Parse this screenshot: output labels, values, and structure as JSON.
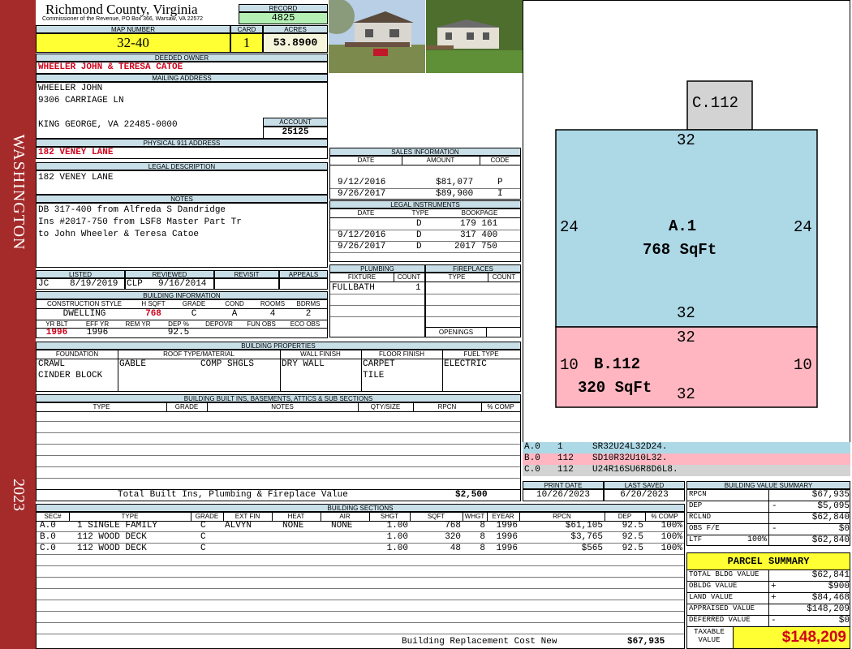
{
  "side": {
    "district": "WASHINGTON",
    "year": "2023"
  },
  "county": {
    "name": "Richmond County, Virginia",
    "office": "Commissioner of the Revenue, PO Box 366, Warsaw, VA 22572"
  },
  "labels": {
    "record": "RECORD",
    "map_number": "MAP NUMBER",
    "card": "CARD",
    "acres": "ACRES",
    "deeded_owner": "DEEDED OWNER",
    "mailing_address": "MAILING ADDRESS",
    "account": "ACCOUNT",
    "physical_address": "PHYSICAL 911 ADDRESS",
    "legal_description": "LEGAL DESCRIPTION",
    "notes": "NOTES",
    "sales_information": "SALES INFORMATION",
    "date": "DATE",
    "amount": "AMOUNT",
    "code": "CODE",
    "legal_instruments": "LEGAL INSTRUMENTS",
    "type": "TYPE",
    "bookpage": "BOOKPAGE",
    "plumbing": "PLUMBING",
    "fireplaces": "FIREPLACES",
    "fixture": "FIXTURE",
    "count": "COUNT",
    "openings": "OPENINGS",
    "listed": "LISTED",
    "reviewed": "REVIEWED",
    "revisit": "REVISIT",
    "appeals": "APPEALS",
    "building_information": "BUILDING INFORMATION",
    "construction_style": "CONSTRUCTION STYLE",
    "h_sqft": "H SQFT",
    "grade": "GRADE",
    "cond": "COND",
    "rooms": "ROOMS",
    "bdrms": "BDRMS",
    "yr_blt": "YR BLT",
    "eff_yr": "EFF YR",
    "rem_yr": "REM YR",
    "dep_pct": "DEP %",
    "depovr": "DEPOVR",
    "fun_obs": "FUN OBS",
    "eco_obs": "ECO OBS",
    "building_properties": "BUILDING PROPERTIES",
    "foundation": "FOUNDATION",
    "roof": "ROOF TYPE/MATERIAL",
    "wall_finish": "WALL FINISH",
    "floor_finish": "FLOOR FINISH",
    "fuel_type": "FUEL TYPE",
    "built_ins": "BUILDING BUILT INS, BASEMENTS, ATTICS & SUB SECTIONS",
    "notes_col": "NOTES",
    "qty_size": "QTY/SIZE",
    "rpcn": "RPCN",
    "pct_comp": "% COMP",
    "print_date": "PRINT DATE",
    "last_saved": "LAST SAVED",
    "building_value_summary": "BUILDING VALUE SUMMARY",
    "building_sections": "BUILDING SECTIONS",
    "sec": "SEC#",
    "ext_fin": "EXT FIN",
    "heat": "HEAT",
    "air": "AIR",
    "shgt": "SHGT",
    "sqft": "SQFT",
    "whgt": "WHGT",
    "eyear": "EYEAR",
    "dep": "DEP"
  },
  "record": "4825",
  "map_number": "32-40",
  "card": "1",
  "acres": "53.8900",
  "owner": "WHEELER JOHN & TERESA CATOE",
  "mailing": [
    "WHEELER JOHN",
    "9306 CARRIAGE LN",
    "",
    "KING GEORGE, VA 22485-0000"
  ],
  "account": "25125",
  "physical_address": "182 VENEY LANE",
  "legal_description": "182 VENEY LANE",
  "notes": [
    "DB 317-400 from Alfreda S Dandridge",
    "Ins #2017-750 from LSF8 Master Part Tr",
    "to John Wheeler & Teresa Catoe"
  ],
  "sales": [
    {
      "date": "9/12/2016",
      "amount": "$81,077",
      "code": "P"
    },
    {
      "date": "9/26/2017",
      "amount": "$89,900",
      "code": "I"
    }
  ],
  "instruments": [
    {
      "date": "",
      "type": "D",
      "bookpage": "179 161"
    },
    {
      "date": "9/12/2016",
      "type": "D",
      "bookpage": "317 400"
    },
    {
      "date": "9/26/2017",
      "type": "D",
      "bookpage": "2017 750"
    }
  ],
  "plumbing": [
    {
      "fixture": "FULLBATH",
      "count": "1"
    }
  ],
  "listing": {
    "listed_by": "JC",
    "listed_date": "8/19/2019",
    "reviewed_by": "CLP",
    "reviewed_date": "9/16/2014"
  },
  "building_info": {
    "style": "DWELLING",
    "h_sqft": "768",
    "grade": "C",
    "cond": "A",
    "rooms": "4",
    "bdrms": "2",
    "yr_blt": "1996",
    "eff_yr": "1996",
    "dep_pct": "92.5"
  },
  "properties": {
    "foundation": [
      "CRAWL",
      "CINDER BLOCK"
    ],
    "roof_type": "GABLE",
    "roof_material": "COMP SHGLS",
    "wall": "DRY WALL",
    "floor": [
      "CARPET",
      "TILE"
    ],
    "fuel": "ELECTRIC"
  },
  "built_ins_total": {
    "label": "Total Built Ins, Plumbing & Fireplace Value",
    "value": "$2,500"
  },
  "sketch": {
    "sections": [
      {
        "name": "A.1",
        "area": "768 SqFt",
        "top": "32",
        "bottom": "32",
        "left": "24",
        "right": "24",
        "color": "#add8e6"
      },
      {
        "name": "B.112",
        "area": "320 SqFt",
        "top": "32",
        "bottom": "32",
        "left": "10",
        "right": "10",
        "color": "#ffb6c1"
      },
      {
        "name": "C.112",
        "color": "#d3d3d3"
      }
    ],
    "codes": [
      {
        "sec": "A.0",
        "code": "1",
        "path": "SR32U24L32D24.",
        "color": "#add8e6"
      },
      {
        "sec": "B.0",
        "code": "112",
        "path": "SD10R32U10L32.",
        "color": "#ffb6c1"
      },
      {
        "sec": "C.0",
        "code": "112",
        "path": "U24R16SU6R8D6L8.",
        "color": "#d3d3d3"
      }
    ]
  },
  "print_date": "10/26/2023",
  "last_saved": "6/20/2023",
  "value_summary": [
    {
      "label": "RPCN",
      "sign": "",
      "pct": "",
      "value": "$67,935"
    },
    {
      "label": "DEP",
      "sign": "-",
      "pct": "",
      "value": "$5,095"
    },
    {
      "label": "RCLND",
      "sign": "",
      "pct": "",
      "value": "$62,840"
    },
    {
      "label": "OBS F/E",
      "sign": "-",
      "pct": "",
      "value": "$0"
    },
    {
      "label": "LTF",
      "sign": "",
      "pct": "100%",
      "value": "$62,840"
    }
  ],
  "parcel_summary": {
    "title": "PARCEL SUMMARY",
    "rows": [
      {
        "label": "TOTAL BLDG VALUE",
        "sign": "",
        "value": "$62,841"
      },
      {
        "label": "OBLDG VALUE",
        "sign": "+",
        "value": "$900"
      },
      {
        "label": "LAND VALUE",
        "sign": "+",
        "value": "$84,468"
      },
      {
        "label": "APPRAISED VALUE",
        "sign": "",
        "value": "$148,209"
      },
      {
        "label": "DEFERRED VALUE",
        "sign": "-",
        "value": "$0"
      }
    ],
    "taxable_label": "TAXABLE VALUE",
    "taxable_value": "$148,209"
  },
  "sections": [
    {
      "sec": "A.0",
      "type": "1 SINGLE FAMILY",
      "grade": "C",
      "ext": "ALVYN",
      "heat": "NONE",
      "air": "NONE",
      "shgt": "1.00",
      "sqft": "768",
      "whgt": "8",
      "eyear": "1996",
      "rpcn": "$61,105",
      "dep": "92.5",
      "comp": "100%"
    },
    {
      "sec": "B.0",
      "type": "112 WOOD DECK",
      "grade": "C",
      "ext": "",
      "heat": "",
      "air": "",
      "shgt": "1.00",
      "sqft": "320",
      "whgt": "8",
      "eyear": "1996",
      "rpcn": "$3,765",
      "dep": "92.5",
      "comp": "100%"
    },
    {
      "sec": "C.0",
      "type": "112 WOOD DECK",
      "grade": "C",
      "ext": "",
      "heat": "",
      "air": "",
      "shgt": "1.00",
      "sqft": "48",
      "whgt": "8",
      "eyear": "1996",
      "rpcn": "$565",
      "dep": "92.5",
      "comp": "100%"
    }
  ],
  "replacement": {
    "label": "Building Replacement Cost New",
    "value": "$67,935"
  }
}
